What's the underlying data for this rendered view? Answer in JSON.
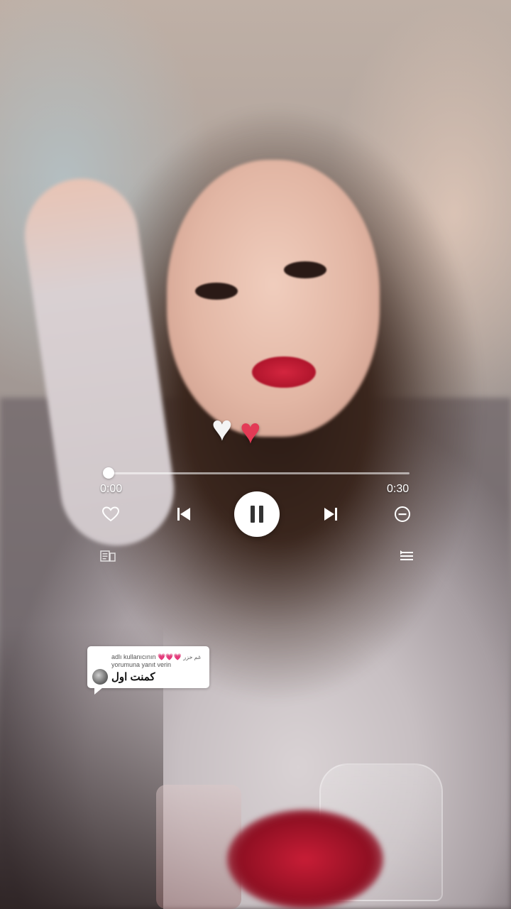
{
  "player": {
    "progress": 0.0,
    "elapsed": "0:00",
    "total": "0:30",
    "state": "playing",
    "icons": {
      "like": "heart-outline-icon",
      "previous": "skip-previous-icon",
      "play_pause": "pause-icon",
      "next": "skip-next-icon",
      "remove": "minus-circle-icon",
      "lyrics": "lyrics-icon",
      "queue": "queue-list-icon"
    }
  },
  "decoration": {
    "hearts": [
      "white-heart-icon",
      "red-heart-icon"
    ]
  },
  "comment": {
    "line1_prefix": "adlı kullanıcının",
    "line1_hearts": "💗💗💗",
    "username": "غم خزر",
    "line2": "yorumuna yanıt verin",
    "text": "كمنت اول"
  },
  "colors": {
    "accent_heart": "#e33a55",
    "controls": "#ffffff",
    "comment_bg": "#ffffff"
  }
}
